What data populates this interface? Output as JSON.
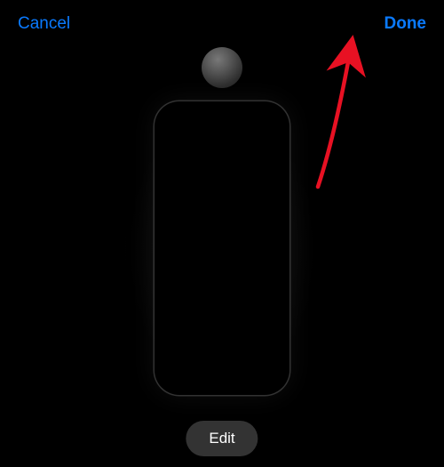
{
  "nav": {
    "cancel_label": "Cancel",
    "done_label": "Done"
  },
  "preview": {
    "edit_label": "Edit"
  },
  "colors": {
    "accent": "#0a7aff"
  }
}
